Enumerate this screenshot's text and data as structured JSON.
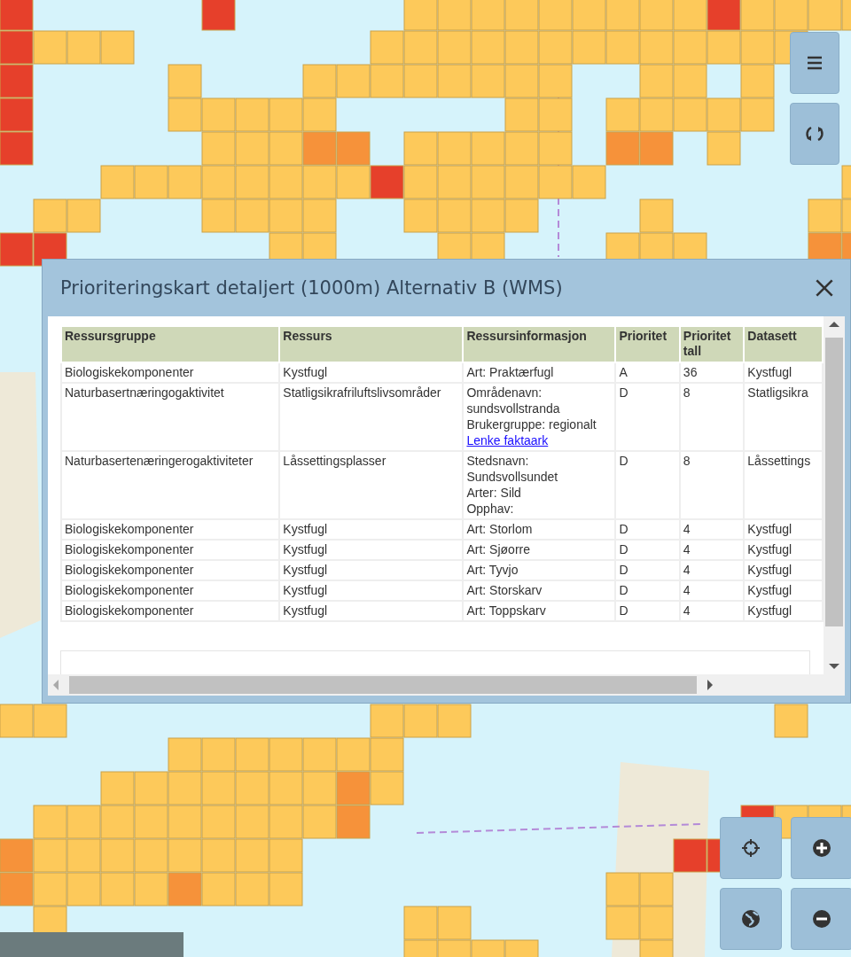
{
  "popup": {
    "title": "Prioriteringskart detaljert (1000m) Alternativ B (WMS)",
    "table": {
      "columns": [
        "Ressursgruppe",
        "Ressurs",
        "Ressursinformasjon",
        "Prioritet",
        "Prioritet tall",
        "Datasett"
      ],
      "rows": [
        {
          "cells": [
            "Biologiskekomponenter",
            "Kystfugl",
            [
              {
                "kind": "text",
                "text": "Art: Praktærfugl"
              }
            ],
            "A",
            "36",
            "Kystfugl"
          ]
        },
        {
          "cells": [
            "Naturbasertnæringogaktivitet",
            "Statligsikrafriluftslivsområder",
            [
              {
                "kind": "text",
                "text": "Områdenavn: sundsvollstranda"
              },
              {
                "kind": "text",
                "text": "Brukergruppe: regionalt"
              },
              {
                "kind": "link",
                "text": "Lenke faktaark"
              }
            ],
            "D",
            "8",
            "Statligsikra"
          ]
        },
        {
          "cells": [
            "Naturbasertenæringerogaktiviteter",
            "Låssettingsplasser",
            [
              {
                "kind": "text",
                "text": "Stedsnavn: Sundsvollsundet"
              },
              {
                "kind": "text",
                "text": "Arter: Sild"
              },
              {
                "kind": "text",
                "text": "Opphav:"
              }
            ],
            "D",
            "8",
            "Låssettings"
          ]
        },
        {
          "cells": [
            "Biologiskekomponenter",
            "Kystfugl",
            [
              {
                "kind": "text",
                "text": "Art: Storlom"
              }
            ],
            "D",
            "4",
            "Kystfugl"
          ]
        },
        {
          "cells": [
            "Biologiskekomponenter",
            "Kystfugl",
            [
              {
                "kind": "text",
                "text": "Art: Sjøorre"
              }
            ],
            "D",
            "4",
            "Kystfugl"
          ]
        },
        {
          "cells": [
            "Biologiskekomponenter",
            "Kystfugl",
            [
              {
                "kind": "text",
                "text": "Art: Tyvjo"
              }
            ],
            "D",
            "4",
            "Kystfugl"
          ]
        },
        {
          "cells": [
            "Biologiskekomponenter",
            "Kystfugl",
            [
              {
                "kind": "text",
                "text": "Art: Storskarv"
              }
            ],
            "D",
            "4",
            "Kystfugl"
          ]
        },
        {
          "cells": [
            "Biologiskekomponenter",
            "Kystfugl",
            [
              {
                "kind": "text",
                "text": "Art: Toppskarv"
              }
            ],
            "D",
            "4",
            "Kystfugl"
          ]
        }
      ]
    }
  }
}
